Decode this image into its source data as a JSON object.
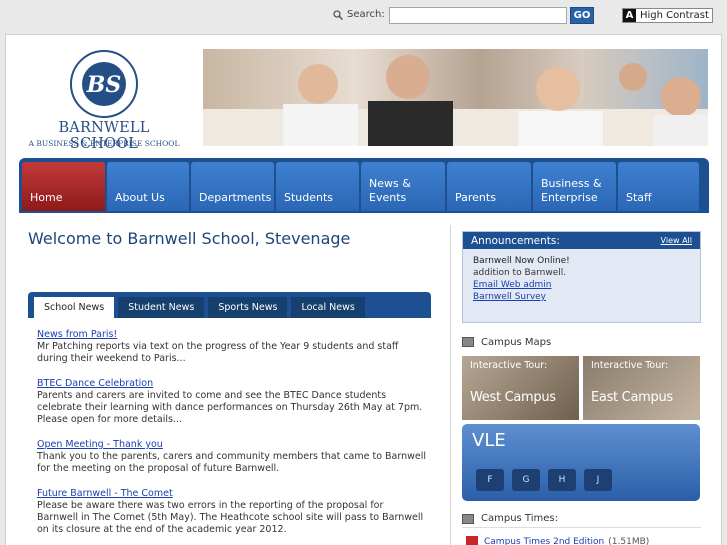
{
  "topbar": {
    "search_label": "Search:",
    "search_placeholder": "",
    "go_label": "GO",
    "contrast_icon": "A",
    "contrast_label": "High Contrast"
  },
  "logo": {
    "crest_text": "BS",
    "name": "BARNWELL SCHOOL",
    "tagline": "A BUSINESS & ENTERPRISE SCHOOL"
  },
  "nav": [
    {
      "label": "Home",
      "active": true
    },
    {
      "label": "About Us"
    },
    {
      "label": "Departments"
    },
    {
      "label": "Students"
    },
    {
      "label": "News & Events"
    },
    {
      "label": "Parents"
    },
    {
      "label": "Business & Enterprise"
    },
    {
      "label": "Staff"
    }
  ],
  "welcome": "Welcome to Barnwell School, Stevenage",
  "news_tabs": [
    {
      "label": "School News",
      "active": true
    },
    {
      "label": "Student News"
    },
    {
      "label": "Sports News"
    },
    {
      "label": "Local News"
    }
  ],
  "news": [
    {
      "title": "News from Paris!",
      "text": "Mr Patching reports via text on the progress of the Year 9 students and staff during their weekend to Paris..."
    },
    {
      "title": "BTEC Dance Celebration",
      "text": "Parents and carers are invited to come and see the BTEC Dance students celebrate their learning with dance performances on Thursday 26th May at 7pm. Please open for more details..."
    },
    {
      "title": "Open Meeting - Thank you",
      "text": "Thank you to the parents, carers and community members that came to Barnwell for the meeting on the proposal of future Barnwell."
    },
    {
      "title": "Future Barnwell - The Comet",
      "text": "Please be aware there was two errors in the reporting of the proposal for Barnwell in The Comet (5th May). The Heathcote school site will pass to Barnwell on its closure at the end of the academic year 2012."
    }
  ],
  "announcements": {
    "title": "Announcements:",
    "view_all": "View All",
    "heading": "Barnwell Now Online!",
    "text": "addition to Barnwell.",
    "link1": "Email Web admin",
    "link2": "Barnwell Survey"
  },
  "maps": {
    "title": "Campus Maps",
    "west_small": "Interactive Tour:",
    "west_big": "West Campus",
    "east_small": "Interactive Tour:",
    "east_big": "East Campus"
  },
  "vle": {
    "title": "VLE",
    "keys": [
      "F",
      "G",
      "H",
      "J"
    ]
  },
  "campus_times": {
    "title": "Campus Times:",
    "item": "Campus Times 2nd Edition",
    "size": "(1.51MB)"
  }
}
